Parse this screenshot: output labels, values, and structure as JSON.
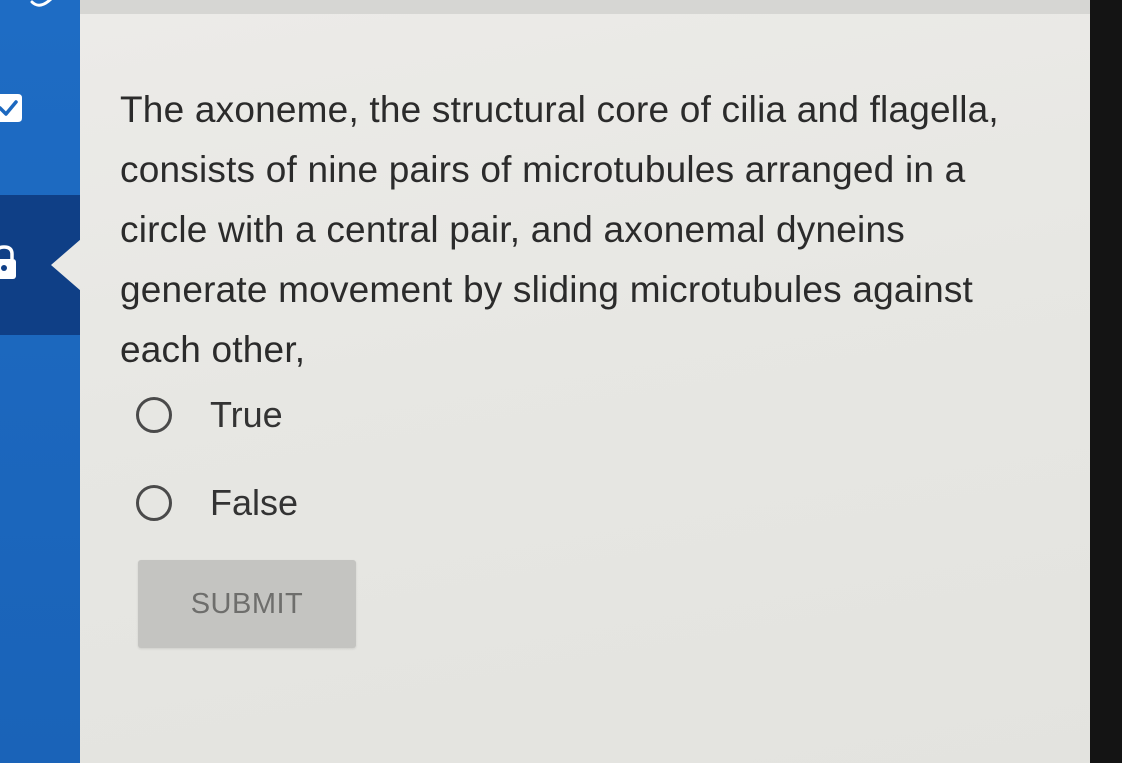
{
  "sidebar": {
    "items": [
      {
        "icon": "check-badge-icon",
        "active": false
      },
      {
        "icon": "lock-icon",
        "active": true
      }
    ],
    "colors": {
      "background": "#1c68bf",
      "active": "#0f3f86"
    }
  },
  "question": {
    "text": "The axoneme, the structural core of cilia and flagella, consists of nine pairs of microtubules arranged in a circle with a central pair, and axonemal dyneins generate movement by sliding microtubules against each other,"
  },
  "options": [
    {
      "label": "True",
      "selected": false
    },
    {
      "label": "False",
      "selected": false
    }
  ],
  "submit": {
    "label": "SUBMIT",
    "enabled": false
  }
}
